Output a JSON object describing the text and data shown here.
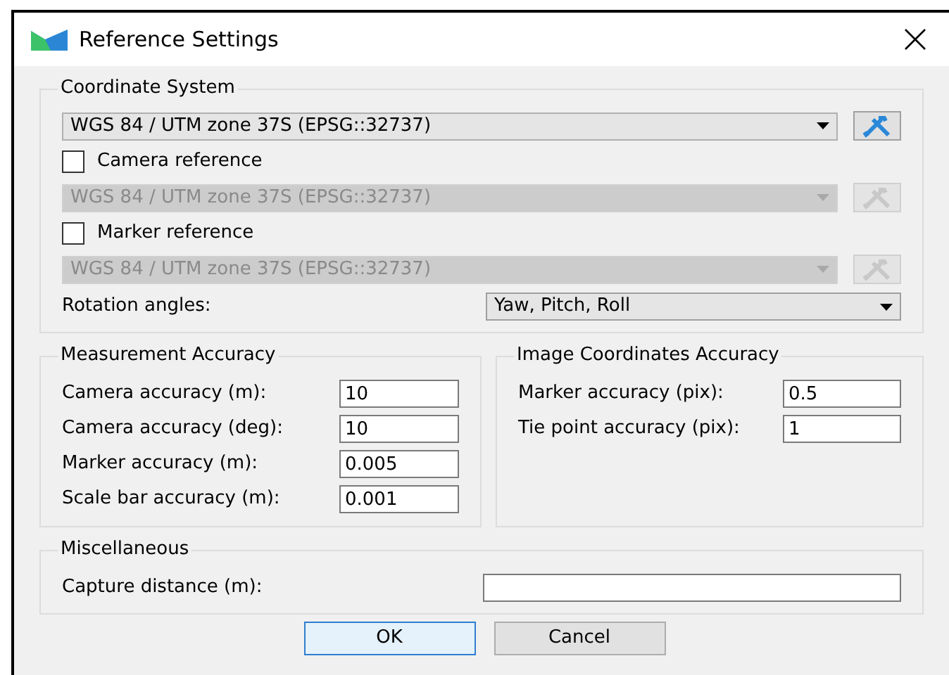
{
  "window": {
    "title": "Reference Settings"
  },
  "coordinate_system": {
    "title": "Coordinate System",
    "rows": [
      {
        "kind": "select",
        "value": "WGS 84 / UTM zone 37S (EPSG::32737)",
        "disabled": false
      },
      {
        "kind": "checkbox",
        "label": "Camera reference",
        "checked": false
      },
      {
        "kind": "select",
        "value": "WGS 84 / UTM zone 37S (EPSG::32737)",
        "disabled": true
      },
      {
        "kind": "checkbox",
        "label": "Marker reference",
        "checked": false
      },
      {
        "kind": "select",
        "value": "WGS 84 / UTM zone 37S (EPSG::32737)",
        "disabled": true
      }
    ],
    "rotation": {
      "label": "Rotation angles:",
      "value": "Yaw, Pitch, Roll"
    }
  },
  "measurement_accuracy": {
    "title": "Measurement Accuracy",
    "fields": [
      {
        "label": "Camera accuracy (m):",
        "value": "10"
      },
      {
        "label": "Camera accuracy (deg):",
        "value": "10"
      },
      {
        "label": "Marker accuracy (m):",
        "value": "0.005"
      },
      {
        "label": "Scale bar accuracy (m):",
        "value": "0.001"
      }
    ]
  },
  "image_coordinates_accuracy": {
    "title": "Image Coordinates Accuracy",
    "fields": [
      {
        "label": "Marker accuracy (pix):",
        "value": "0.5"
      },
      {
        "label": "Tie point accuracy (pix):",
        "value": "1"
      }
    ]
  },
  "miscellaneous": {
    "title": "Miscellaneous",
    "fields": [
      {
        "label": "Capture distance (m):"
      }
    ]
  },
  "buttons": [
    {
      "label": "OK",
      "default": true
    },
    {
      "label": "Cancel",
      "default": false
    }
  ]
}
